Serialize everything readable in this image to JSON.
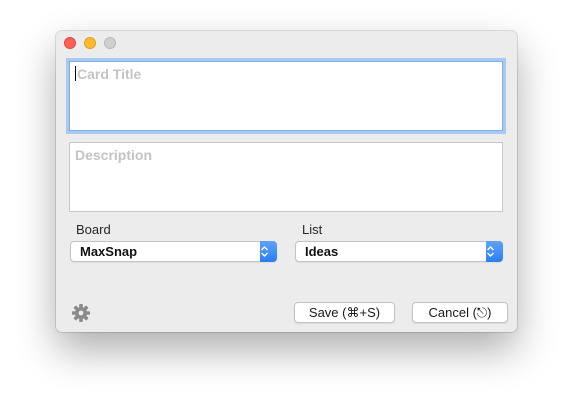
{
  "window": {
    "controls": [
      "close",
      "minimize",
      "zoom"
    ]
  },
  "card": {
    "title_placeholder": "Card Title",
    "description_placeholder": "Description"
  },
  "board": {
    "label": "Board",
    "selected": "MaxSnap"
  },
  "list": {
    "label": "List",
    "selected": "Ideas"
  },
  "actions": {
    "save_label": "Save (⌘+S)",
    "cancel_label": "Cancel (⎋)"
  },
  "icons": {
    "settings": "gear-icon",
    "select_arrows": "up-down-chevron-icon"
  },
  "colors": {
    "accent": "#2a7ef2",
    "focus_ring": "#a9c9f0",
    "close": "#fc5f57",
    "minimize": "#fdbc2e"
  }
}
